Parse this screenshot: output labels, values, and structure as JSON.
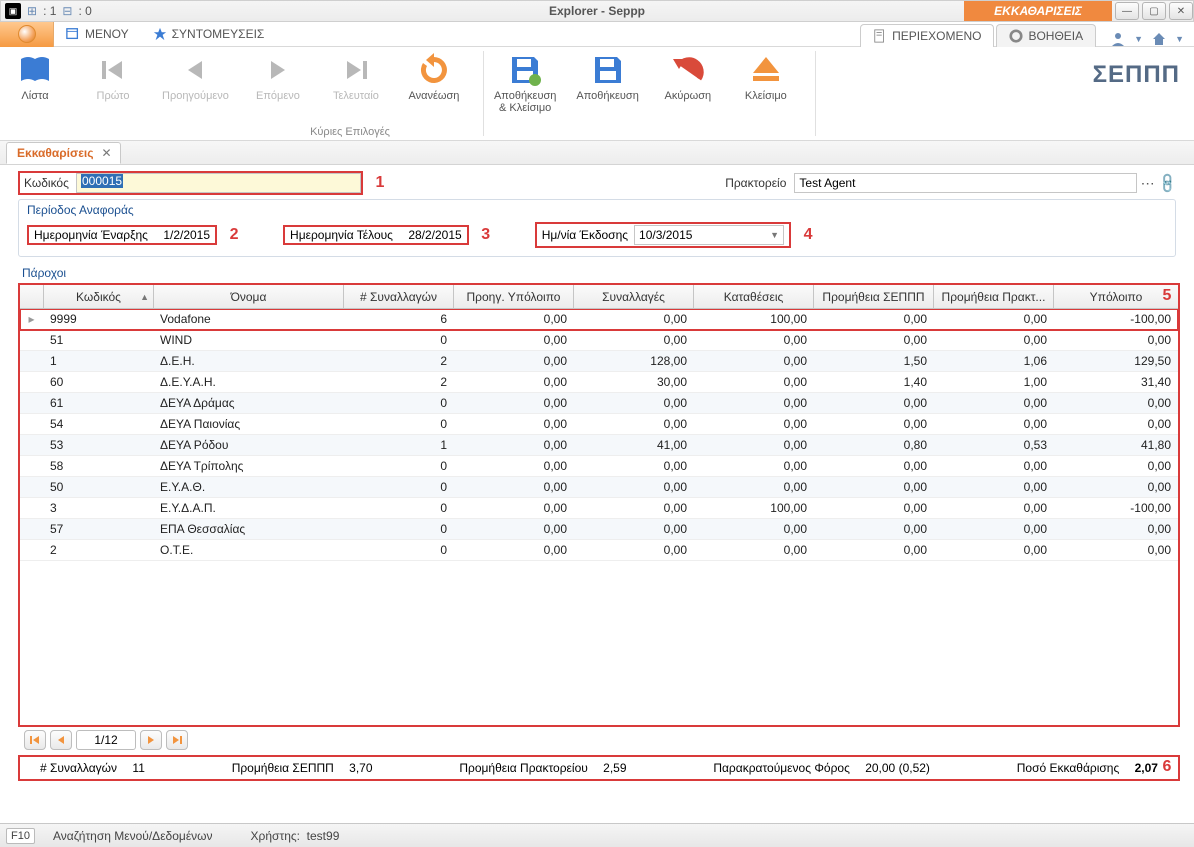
{
  "titlebar": {
    "left_count1": ": 1",
    "left_count2": ": 0",
    "center": "Explorer - Seppp",
    "right_tab": "ΕΚΚΑΘΑΡΙΣΕΙΣ"
  },
  "bar2": {
    "menu": "ΜΕΝΟΥ",
    "shortcuts": "ΣΥΝΤΟΜΕΥΣΕΙΣ",
    "right_tab_content": "ΠΕΡΙΕΧΟΜΕΝΟ",
    "right_tab_help": "ΒΟΗΘΕΙΑ"
  },
  "ribbon": {
    "list": "Λίστα",
    "first": "Πρώτο",
    "prev": "Προηγούμενο",
    "next": "Επόμενο",
    "last": "Τελευταίο",
    "refresh": "Ανανέωση",
    "save_close": "Αποθήκευση\n& Κλείσιμο",
    "save": "Αποθήκευση",
    "cancel": "Ακύρωση",
    "close": "Κλείσιμο",
    "group_caption": "Κύριες Επιλογές",
    "brand": "ΣΕΠΠΠ"
  },
  "doc_tab": {
    "label": "Εκκαθαρίσεις"
  },
  "form": {
    "code_label": "Κωδικός",
    "code_value": "000015",
    "agent_label": "Πρακτορείο",
    "agent_value": "Test Agent"
  },
  "period": {
    "title": "Περίοδος Αναφοράς",
    "start_label": "Ημερομηνία Έναρξης",
    "start_value": "1/2/2015",
    "end_label": "Ημερομηνία Τέλους",
    "end_value": "28/2/2015",
    "issue_label": "Ημ/νία Έκδοσης",
    "issue_value": "10/3/2015"
  },
  "markers": {
    "m1": "1",
    "m2": "2",
    "m3": "3",
    "m4": "4",
    "m5": "5",
    "m6": "6"
  },
  "grid": {
    "title": "Πάροχοι",
    "headers": {
      "code": "Κωδικός",
      "name": "Όνομα",
      "count": "# Συναλλαγών",
      "prev": "Προηγ. Υπόλοιπο",
      "trans": "Συναλλαγές",
      "dep": "Καταθέσεις",
      "feeS": "Προμήθεια ΣΕΠΠΠ",
      "feeA": "Προμήθεια Πρακτ...",
      "bal": "Υπόλοιπο"
    },
    "rows": [
      {
        "code": "9999",
        "name": "Vodafone",
        "count": "6",
        "prev": "0,00",
        "trans": "0,00",
        "dep": "100,00",
        "feeS": "0,00",
        "feeA": "0,00",
        "bal": "-100,00"
      },
      {
        "code": "51",
        "name": "WIND",
        "count": "0",
        "prev": "0,00",
        "trans": "0,00",
        "dep": "0,00",
        "feeS": "0,00",
        "feeA": "0,00",
        "bal": "0,00"
      },
      {
        "code": "1",
        "name": "Δ.Ε.Η.",
        "count": "2",
        "prev": "0,00",
        "trans": "128,00",
        "dep": "0,00",
        "feeS": "1,50",
        "feeA": "1,06",
        "bal": "129,50"
      },
      {
        "code": "60",
        "name": "Δ.Ε.Υ.Α.Η.",
        "count": "2",
        "prev": "0,00",
        "trans": "30,00",
        "dep": "0,00",
        "feeS": "1,40",
        "feeA": "1,00",
        "bal": "31,40"
      },
      {
        "code": "61",
        "name": "ΔΕΥΑ Δράμας",
        "count": "0",
        "prev": "0,00",
        "trans": "0,00",
        "dep": "0,00",
        "feeS": "0,00",
        "feeA": "0,00",
        "bal": "0,00"
      },
      {
        "code": "54",
        "name": "ΔΕΥΑ Παιονίας",
        "count": "0",
        "prev": "0,00",
        "trans": "0,00",
        "dep": "0,00",
        "feeS": "0,00",
        "feeA": "0,00",
        "bal": "0,00"
      },
      {
        "code": "53",
        "name": "ΔΕΥΑ Ρόδου",
        "count": "1",
        "prev": "0,00",
        "trans": "41,00",
        "dep": "0,00",
        "feeS": "0,80",
        "feeA": "0,53",
        "bal": "41,80"
      },
      {
        "code": "58",
        "name": "ΔΕΥΑ Τρίπολης",
        "count": "0",
        "prev": "0,00",
        "trans": "0,00",
        "dep": "0,00",
        "feeS": "0,00",
        "feeA": "0,00",
        "bal": "0,00"
      },
      {
        "code": "50",
        "name": "Ε.Υ.Α.Θ.",
        "count": "0",
        "prev": "0,00",
        "trans": "0,00",
        "dep": "0,00",
        "feeS": "0,00",
        "feeA": "0,00",
        "bal": "0,00"
      },
      {
        "code": "3",
        "name": "Ε.Υ.Δ.Α.Π.",
        "count": "0",
        "prev": "0,00",
        "trans": "0,00",
        "dep": "100,00",
        "feeS": "0,00",
        "feeA": "0,00",
        "bal": "-100,00"
      },
      {
        "code": "57",
        "name": "ΕΠΑ Θεσσαλίας",
        "count": "0",
        "prev": "0,00",
        "trans": "0,00",
        "dep": "0,00",
        "feeS": "0,00",
        "feeA": "0,00",
        "bal": "0,00"
      },
      {
        "code": "2",
        "name": "Ο.Τ.Ε.",
        "count": "0",
        "prev": "0,00",
        "trans": "0,00",
        "dep": "0,00",
        "feeS": "0,00",
        "feeA": "0,00",
        "bal": "0,00"
      }
    ]
  },
  "pager": {
    "text": "1/12"
  },
  "summary": {
    "count_lbl": "# Συναλλαγών",
    "count_val": "11",
    "feeS_lbl": "Προμήθεια ΣΕΠΠΠ",
    "feeS_val": "3,70",
    "feeA_lbl": "Προμήθεια Πρακτορείου",
    "feeA_val": "2,59",
    "tax_lbl": "Παρακρατούμενος Φόρος",
    "tax_val": "20,00 (0,52)",
    "total_lbl": "Ποσό Εκκαθάρισης",
    "total_val": "2,07"
  },
  "statusbar": {
    "key": "F10",
    "search": "Αναζήτηση Μενού/Δεδομένων",
    "user_lbl": "Χρήστης:",
    "user_val": "test99"
  }
}
